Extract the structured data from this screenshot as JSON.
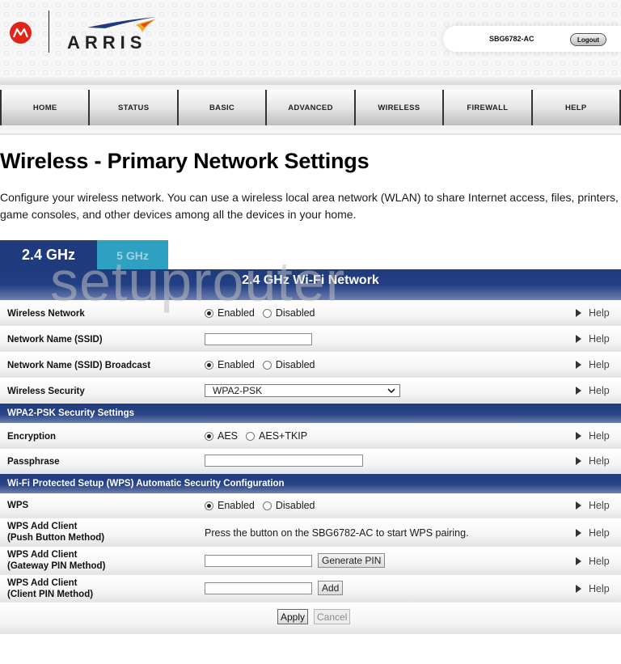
{
  "header": {
    "brand": "ARRIS",
    "model": "SBG6782-AC",
    "logout_label": "Logout",
    "colors": {
      "motorola_red": "#e2231a",
      "arris_blue": "#1f3a7d",
      "arris_orange": "#f5a623"
    }
  },
  "nav": {
    "items": [
      {
        "label": "HOME"
      },
      {
        "label": "STATUS"
      },
      {
        "label": "BASIC"
      },
      {
        "label": "ADVANCED"
      },
      {
        "label": "WIRELESS"
      },
      {
        "label": "FIREWALL"
      },
      {
        "label": "HELP"
      }
    ]
  },
  "page": {
    "title": "Wireless - Primary Network Settings",
    "description": "Configure your wireless network. You can use a wireless local area network (WLAN) to share Internet access, files, printers, game consoles, and other devices among all the devices in your home."
  },
  "tabs": [
    {
      "label": "2.4 GHz",
      "active": true
    },
    {
      "label": "5 GHz",
      "active": false
    }
  ],
  "section_title": "2.4 GHz Wi-Fi Network",
  "watermark": "setuprouter",
  "help_label": "Help",
  "settings": {
    "wireless_network": {
      "label": "Wireless Network",
      "options": [
        "Enabled",
        "Disabled"
      ],
      "selected": "Enabled"
    },
    "ssid": {
      "label": "Network Name (SSID)",
      "value": ""
    },
    "ssid_broadcast": {
      "label": "Network Name (SSID) Broadcast",
      "options": [
        "Enabled",
        "Disabled"
      ],
      "selected": "Enabled"
    },
    "wireless_security": {
      "label": "Wireless Security",
      "value": "WPA2-PSK"
    }
  },
  "wpa2_section": {
    "title": "WPA2-PSK Security Settings",
    "encryption": {
      "label": "Encryption",
      "options": [
        "AES",
        "AES+TKIP"
      ],
      "selected": "AES"
    },
    "passphrase": {
      "label": "Passphrase",
      "value": ""
    }
  },
  "wps_section": {
    "title": "Wi-Fi Protected Setup (WPS) Automatic Security Configuration",
    "wps": {
      "label": "WPS",
      "options": [
        "Enabled",
        "Disabled"
      ],
      "selected": "Enabled"
    },
    "push_button": {
      "label_line1": "WPS Add Client",
      "label_line2": "(Push Button Method)",
      "text": "Press the button on the SBG6782-AC to start WPS pairing."
    },
    "gateway_pin": {
      "label_line1": "WPS Add Client",
      "label_line2": "(Gateway PIN Method)",
      "value": "",
      "button": "Generate PIN"
    },
    "client_pin": {
      "label_line1": "WPS Add Client",
      "label_line2": "(Client PIN Method)",
      "value": "",
      "button": "Add"
    }
  },
  "footer": {
    "apply_label": "Apply",
    "cancel_label": "Cancel"
  }
}
